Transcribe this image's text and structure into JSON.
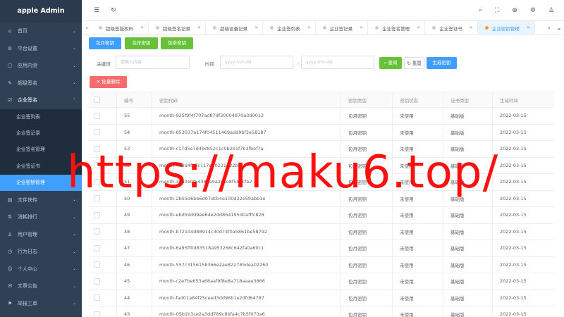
{
  "app": {
    "title": "apple Admin"
  },
  "sidebar": {
    "items": [
      {
        "icon": "⌂",
        "label": "首页",
        "arrow": "⌄"
      },
      {
        "icon": "⚙",
        "label": "平台设置",
        "arrow": "⌄"
      },
      {
        "icon": "▢",
        "label": "应用内测",
        "arrow": "⌄"
      },
      {
        "icon": "✎",
        "label": "超级签名",
        "arrow": "⌄"
      },
      {
        "icon": "☑",
        "label": "企业签名",
        "arrow": "⌃"
      }
    ],
    "submenu": [
      {
        "label": "企业签列表"
      },
      {
        "label": "企业签记录"
      },
      {
        "label": "企业签名管理"
      },
      {
        "label": "企业签证书"
      },
      {
        "label": "企业密钥管理"
      }
    ],
    "items_after": [
      {
        "icon": "▤",
        "label": "文件快传",
        "arrow": "⌄"
      },
      {
        "icon": "⇅",
        "label": "消耗排行",
        "arrow": "⌄"
      },
      {
        "icon": "♙",
        "label": "用户管理",
        "arrow": "⌄"
      },
      {
        "icon": "◷",
        "label": "行为日志",
        "arrow": "⌄"
      },
      {
        "icon": "☺",
        "label": "个人中心",
        "arrow": "⌄"
      },
      {
        "icon": "✉",
        "label": "文章公告",
        "arrow": "⌄"
      },
      {
        "icon": "⚑",
        "label": "举报工单",
        "arrow": "⌄"
      }
    ]
  },
  "topbar": {
    "menu_icon": "☰",
    "refresh_icon": "↻",
    "search_icon": "⌕",
    "fullscreen_icon": "⛶",
    "language_icon": "⊕",
    "settings_icon": "⚙",
    "user_icon": "♙"
  },
  "tabs": {
    "prev": "‹",
    "next": "›",
    "dropdown": "⌄",
    "close": "✕",
    "items": [
      {
        "label": "超级签授权码"
      },
      {
        "label": "超级签名记录"
      },
      {
        "label": "超级设备记录"
      },
      {
        "label": "企业签列表"
      },
      {
        "label": "企业签记录"
      },
      {
        "label": "企业签名管理"
      },
      {
        "label": "企业签证书"
      },
      {
        "label": "企业密钥管理"
      }
    ]
  },
  "toolbar": {
    "monthly_key": "包月密钥",
    "yearly_key": "包年密钥",
    "quarterly_key": "包季密钥",
    "keyword_label": "关键词",
    "keyword_placeholder": "请输入内容",
    "time_label": "时间",
    "start_placeholder": "yyyy-mm-dd",
    "separator": "-",
    "end_placeholder": "yyyy-mm-dd",
    "search": "查询",
    "search_icon": "⌕",
    "reset": "重置",
    "reset_icon": "↻",
    "generate": "生成密钥",
    "batch_delete": "批量删除",
    "batch_delete_icon": "✕"
  },
  "table": {
    "headers": [
      "编号",
      "密钥代码",
      "密钥类型",
      "密钥状态",
      "证书类型",
      "生成时间"
    ],
    "rows": [
      [
        "55",
        "month-925f9f4f707ad87df30004870a3d9012",
        "包月密钥",
        "未使用",
        "基础版",
        "2022-03-15"
      ],
      [
        "54",
        "month-853037a174f04511469add9bf3e58187",
        "包月密钥",
        "未使用",
        "基础版",
        "2022-03-15"
      ],
      [
        "53",
        "month-c17d5e7d4bc852c1c0b2b1f7b3fbef7a",
        "包月密钥",
        "未使用",
        "基础版",
        "2022-03-15"
      ],
      [
        "52",
        "month-4e8d4fe5c117e80231622b9…",
        "包月密钥",
        "未使用",
        "基础版",
        "2022-03-15"
      ],
      [
        "51",
        "month-3ea0e0f54382a9a2c1e8f582cfe2",
        "包月密钥",
        "未使用",
        "基础版",
        "2022-03-15"
      ],
      [
        "50",
        "month-2b55d6bb6d07dcb4e100d32e59abb1e",
        "包月密钥",
        "未使用",
        "基础版",
        "2022-03-15"
      ],
      [
        "49",
        "month-ebd59dd9ee64e2dd864195d0afffc828",
        "包月密钥",
        "未使用",
        "基础版",
        "2022-03-15"
      ],
      [
        "48",
        "month-b721d4d88914c30d74f0a5861be58792",
        "包月密钥",
        "未使用",
        "基础版",
        "2022-03-15"
      ],
      [
        "47",
        "month-6a95ff0d83518a953268c642fa0a60c1",
        "包月密钥",
        "未使用",
        "基础版",
        "2022-03-15"
      ],
      [
        "46",
        "month-557c3156158366e2ae822785dea02260",
        "包月密钥",
        "未使用",
        "基础版",
        "2022-03-15"
      ],
      [
        "45",
        "month-c2e7be653a68aaf9f8e8a718aaae3866",
        "包月密钥",
        "未使用",
        "基础版",
        "2022-03-15"
      ],
      [
        "44",
        "month-fad01a84f25ceed3dd96b1e2dfd64787",
        "包月密钥",
        "未使用",
        "基础版",
        "2022-03-15"
      ],
      [
        "43",
        "month-05b1b3ce2a3dd789c8bfa4c7b5f070a6",
        "包月密钥",
        "未使用",
        "基础版",
        "2022-03-15"
      ]
    ]
  },
  "watermark": "https://maku6.top/"
}
